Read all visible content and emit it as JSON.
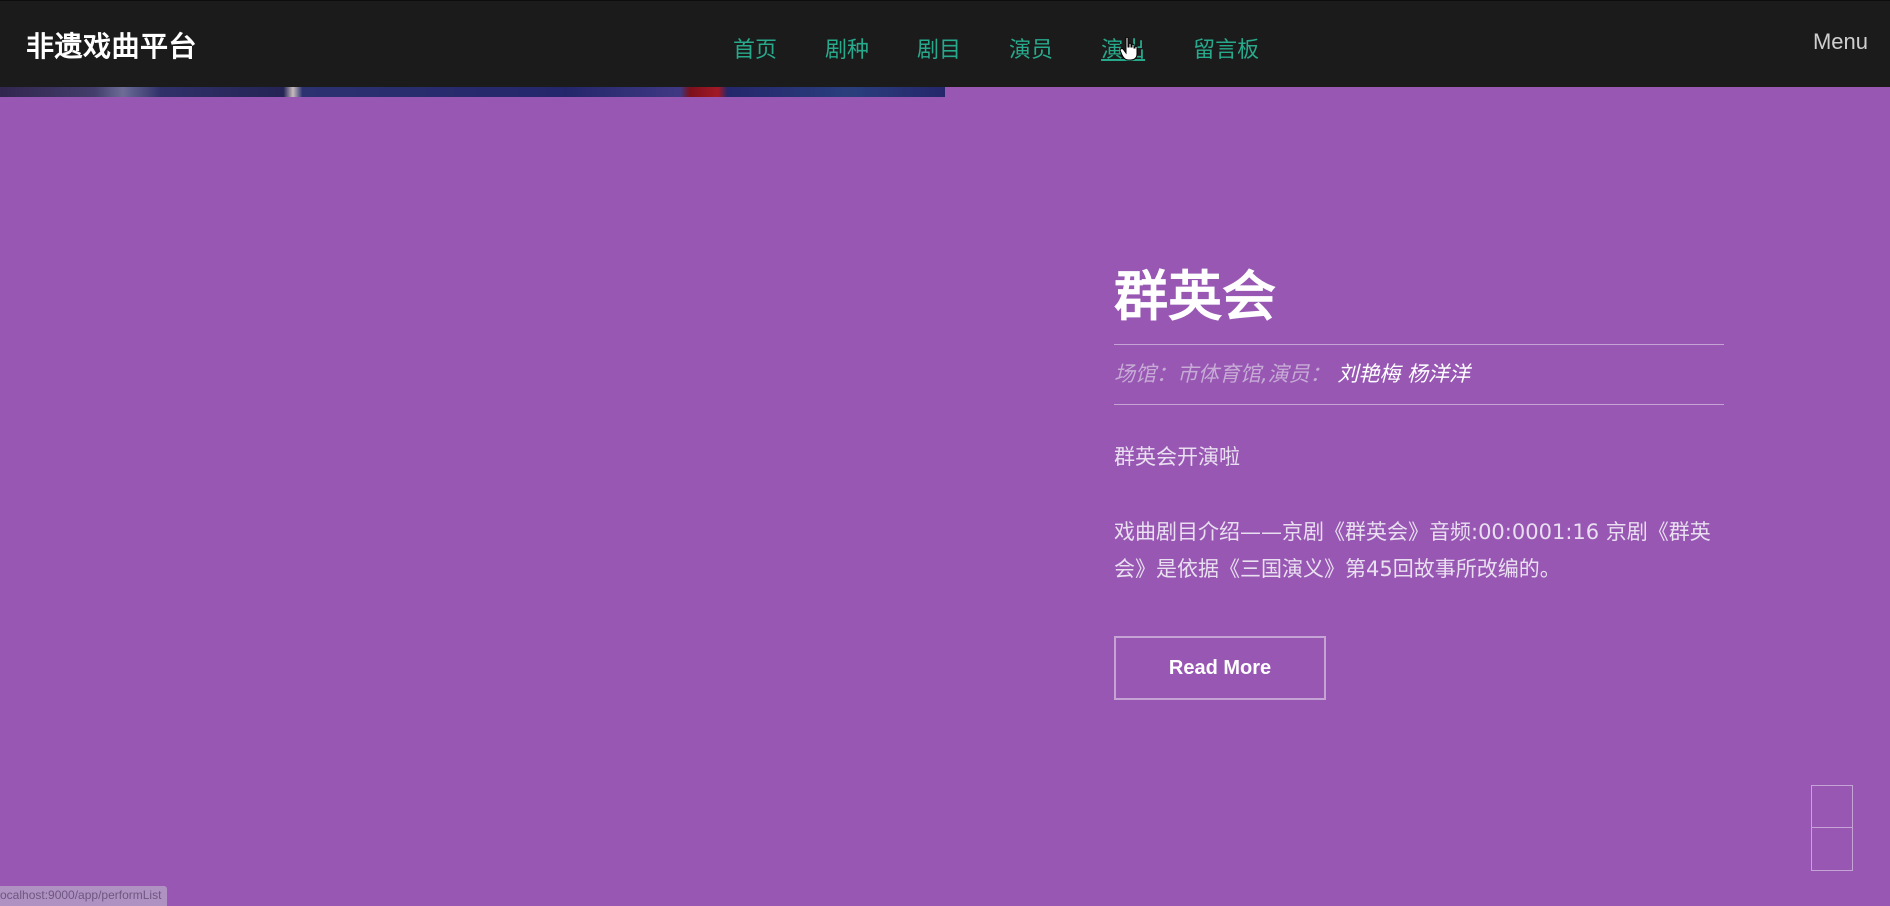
{
  "navbar": {
    "brand": "非遗戏曲平台",
    "links": [
      {
        "label": "首页"
      },
      {
        "label": "剧种"
      },
      {
        "label": "剧目"
      },
      {
        "label": "演员"
      },
      {
        "label": "演出"
      },
      {
        "label": "留言板"
      }
    ],
    "active_index": 4,
    "menu_label": "Menu"
  },
  "hero": {
    "title": "群英会",
    "venue_label": "场馆：",
    "venue": "市体育馆",
    "actors_label": ",演员：",
    "actors": "刘艳梅 杨洋洋",
    "subtitle": "群英会开演啦",
    "description": "戏曲剧目介绍——京剧《群英会》音频:00:0001:16 京剧《群英会》是依据《三国演义》第45回故事所改编的。",
    "read_more_label": "Read More"
  },
  "status_bar": {
    "url": "ocalhost:9000/app/performList"
  },
  "colors": {
    "background": "#9757b3",
    "navbar": "#1b1b1b",
    "nav_link": "#27a98c"
  }
}
